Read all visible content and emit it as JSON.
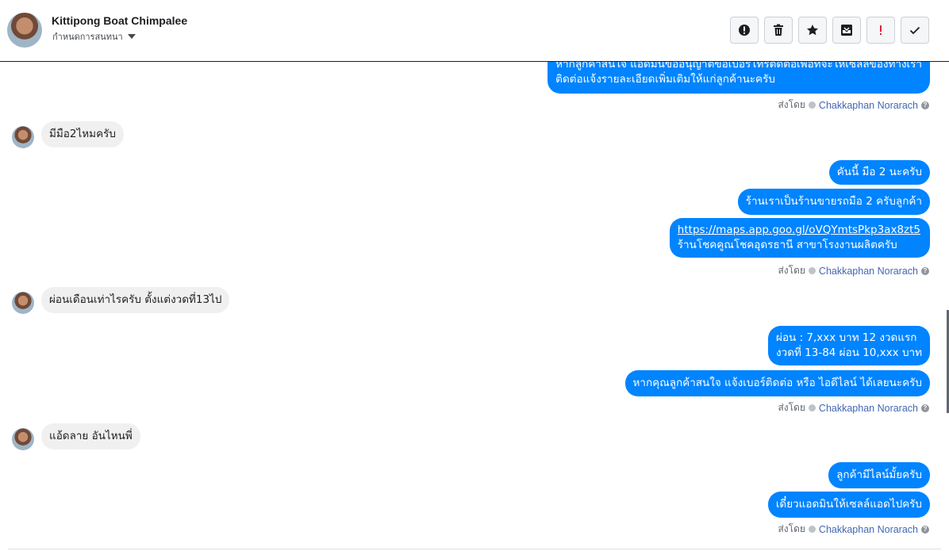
{
  "header": {
    "contact_name": "Kittipong Boat Chimpalee",
    "assign_label": "กำหนดการสนทนา",
    "buttons": [
      {
        "name": "spam-button",
        "icon": "alert-circle-icon"
      },
      {
        "name": "delete-button",
        "icon": "trash-icon"
      },
      {
        "name": "star-button",
        "icon": "star-icon"
      },
      {
        "name": "move-to-inbox-button",
        "icon": "inbox-icon"
      },
      {
        "name": "follow-up-button",
        "icon": "exclamation-icon"
      },
      {
        "name": "mark-done-button",
        "icon": "check-icon"
      }
    ]
  },
  "messages": {
    "m0_line1": "หากลูกค้าสนใจ แอดมินขออนุญาตขอเบอร์โทรติดต่อเพื่อที่จะให้เซลล์ของทางเรา",
    "m0_line2": "ติดต่อแจ้งรายละเอียดเพิ่มเติมให้แก่ลูกค้านะครับ",
    "in1": "มีมือ2ไหมครับ",
    "out1": "คันนี้ มือ 2 นะครับ",
    "out2": "ร้านเราเป็นร้านขายรถมือ 2 ครับลูกค้า",
    "out3_link": "https://maps.app.goo.gl/oVQYmtsPkp3ax8zt5",
    "out3_line2": "ร้านโชคคูณโชคอุดรธานี สาขาโรงงานผลิตครับ",
    "in2": "ผ่อนเดือนเท่าไรครับ ตั้งแต่งวดที่13ไป",
    "out4_line1": "ผ่อน : 7,xxx บาท 12 งวดแรก",
    "out4_line2": "งวดที่ 13-84 ผ่อน 10,xxx บาท",
    "out5": "หากคุณลูกค้าสนใจ แจ้งเบอร์ติดต่อ หรือ ไอดีไลน์ ได้เลยนะครับ",
    "in3": "แอ้ดลาย อันไหนพี่",
    "out6": "ลูกค้ามีไลน์มั้ยครับ",
    "out7": "เดี๋ยวแอดมินให้เซลล์แอดไปครับ"
  },
  "sent_by": {
    "label": "ส่งโดย",
    "agent": "Chakkaphan Norarach",
    "help": "?"
  },
  "colors": {
    "outgoing": "#0084ff",
    "incoming": "#f1f0f0",
    "agent_link": "#4267b2"
  }
}
